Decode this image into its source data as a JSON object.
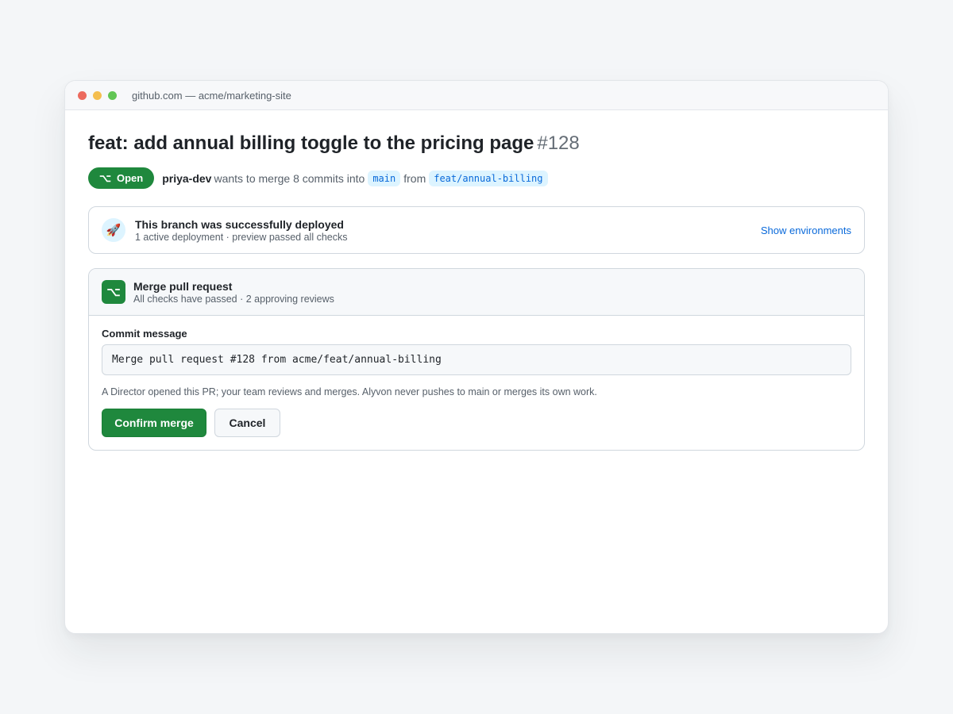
{
  "window": {
    "url": "github.com — acme/marketing-site"
  },
  "pr": {
    "title": "feat: add annual billing toggle to the pricing page",
    "number": "#128",
    "state_glyph": "⌥",
    "state": "Open",
    "author": "priya-dev",
    "action_text": "wants to merge 8 commits into",
    "base_branch": "main",
    "from_text": "from",
    "head_branch": "feat/annual-billing"
  },
  "deployment": {
    "icon": "rocket-icon",
    "title": "This branch was successfully deployed",
    "subtitle": "1 active deployment · preview passed all checks",
    "link": "Show environments"
  },
  "merge": {
    "icon": "merge-icon",
    "icon_glyph": "⌥",
    "title": "Merge pull request",
    "subtitle": "All checks have passed · 2 approving reviews",
    "commit_label": "Commit message",
    "commit_value": "Merge pull request #128 from acme/feat/annual-billing",
    "note": "A Director opened this PR; your team reviews and merges. Alyvon never pushes to main or merges its own work.",
    "confirm_label": "Confirm merge",
    "cancel_label": "Cancel"
  },
  "colors": {
    "accent_green": "#1f883d",
    "link_blue": "#0969da",
    "branch_bg": "#ddf4ff"
  }
}
